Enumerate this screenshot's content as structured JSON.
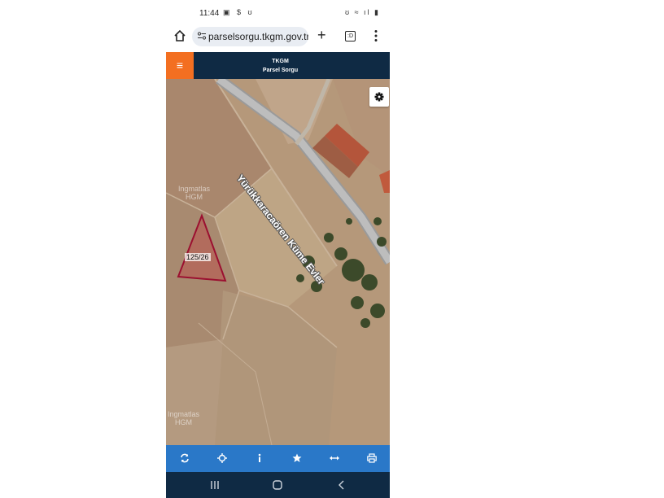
{
  "status_bar": {
    "time": "11:44",
    "left_icons": "▣ $ ʊ",
    "right_icons": "ʊ ≈ ıl ▮"
  },
  "browser": {
    "url": "parselsorgu.tkgm.gov.tr",
    "tab_count": ":D"
  },
  "app_header": {
    "title": "TKGM",
    "subtitle": "Parsel Sorgu",
    "menu_icon": "≡"
  },
  "map": {
    "road_label": "Yürükkaracaören Küme Evler",
    "parcel_label": "125/26",
    "watermark_top": [
      "Ingmatlas",
      "HGM"
    ],
    "watermark_bottom": [
      "Ingmatlas",
      "HGM"
    ]
  },
  "toolbar": {
    "items": [
      "refresh-icon",
      "locate-icon",
      "info-icon",
      "star-icon",
      "measure-icon",
      "print-icon"
    ]
  },
  "colors": {
    "header_bg": "#0f2a44",
    "menu_accent": "#f36f21",
    "toolbar_bg": "#2a78c8",
    "parcel_stroke": "#9b1030"
  }
}
